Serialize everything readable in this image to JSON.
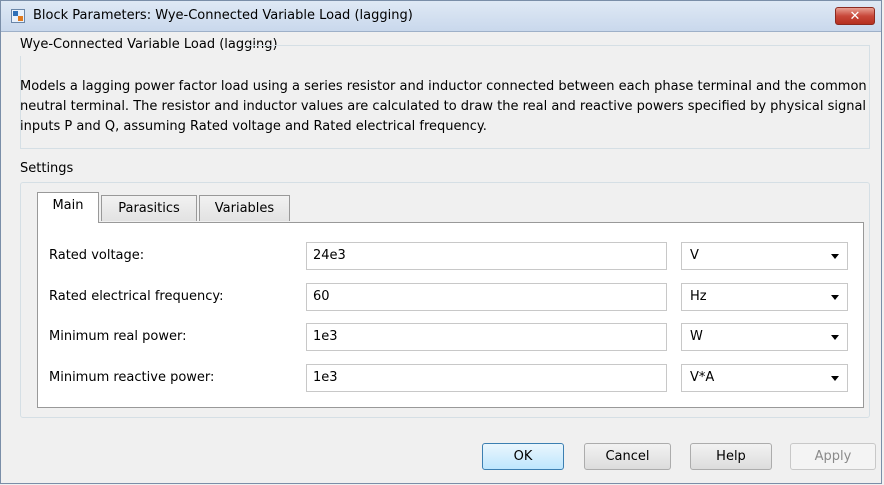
{
  "window": {
    "title": "Block Parameters: Wye-Connected Variable Load (lagging)",
    "close_label": "✕"
  },
  "block": {
    "name": "Wye-Connected Variable Load (lagging)",
    "description": "Models a lagging power factor load using a series resistor and inductor connected between each phase terminal and the common neutral terminal. The resistor and inductor values are calculated to draw the real and reactive powers specified by physical signal inputs P and Q, assuming Rated voltage and Rated electrical frequency."
  },
  "settings": {
    "label": "Settings",
    "tabs": [
      {
        "label": "Main",
        "active": true
      },
      {
        "label": "Parasitics",
        "active": false
      },
      {
        "label": "Variables",
        "active": false
      }
    ],
    "params": [
      {
        "label": "Rated voltage:",
        "value": "24e3",
        "unit": "V"
      },
      {
        "label": "Rated electrical frequency:",
        "value": "60",
        "unit": "Hz"
      },
      {
        "label": "Minimum real power:",
        "value": "1e3",
        "unit": "W"
      },
      {
        "label": "Minimum reactive power:",
        "value": "1e3",
        "unit": "V*A"
      }
    ]
  },
  "buttons": {
    "ok": "OK",
    "cancel": "Cancel",
    "help": "Help",
    "apply": "Apply"
  },
  "icons": {
    "app": "simulink-block-icon",
    "dropdown": "chevron-down-icon"
  }
}
